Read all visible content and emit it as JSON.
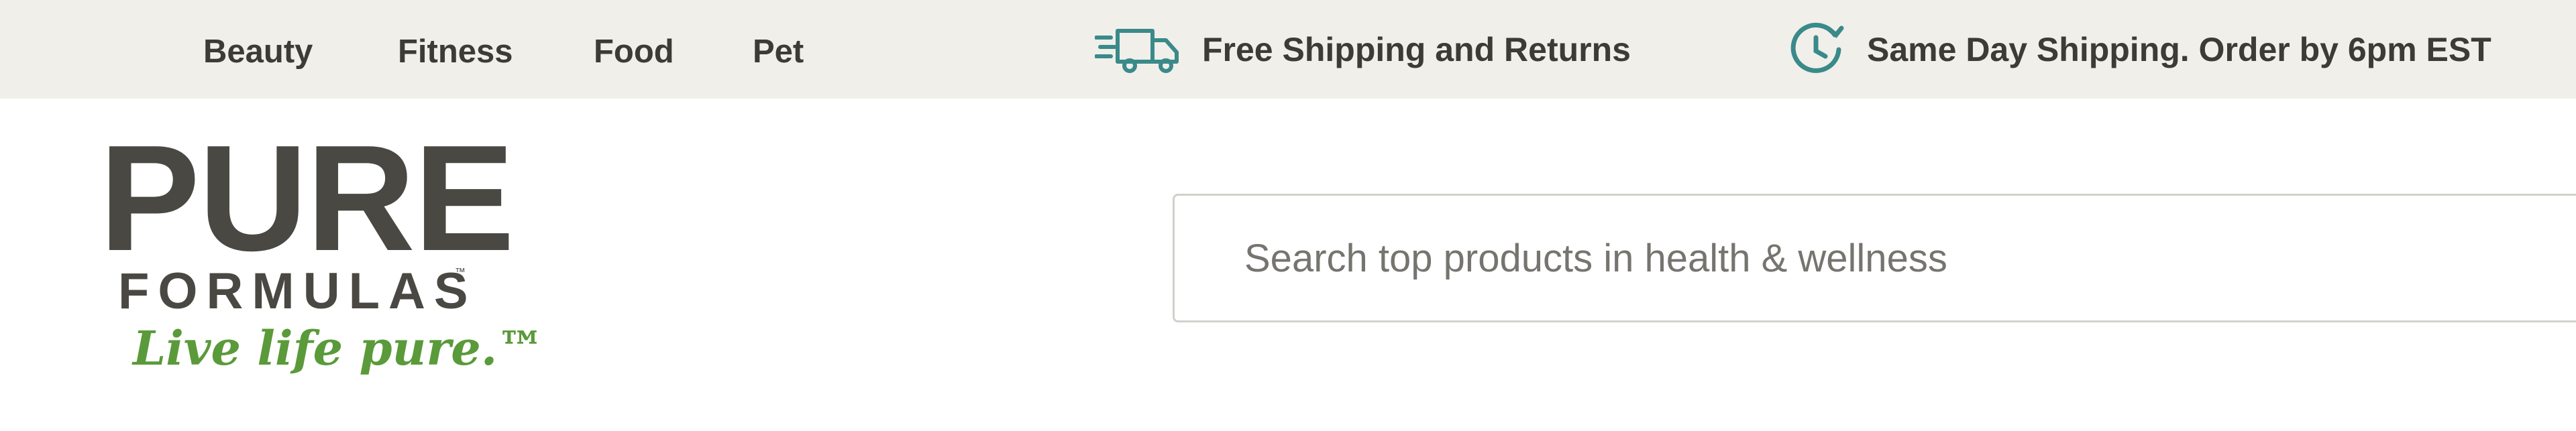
{
  "topbar": {
    "categories": [
      "Beauty",
      "Fitness",
      "Food",
      "Pet"
    ],
    "promo_shipping": {
      "icon": "delivery-truck-icon",
      "text": "Free Shipping and Returns"
    },
    "promo_sameday": {
      "icon": "clock-icon",
      "text": "Same Day Shipping. Order by 6pm EST"
    }
  },
  "logo": {
    "line1": "PURE",
    "line2": "FORMULAS",
    "trademark": "™",
    "tagline": "Live life pure.™"
  },
  "search": {
    "placeholder": "Search top products in health & wellness",
    "value": ""
  },
  "colors": {
    "topbar_bg": "#f1efea",
    "text_dark": "#3d3b36",
    "icon_teal": "#3a8a8a",
    "brand_green": "#5a9a3a"
  }
}
